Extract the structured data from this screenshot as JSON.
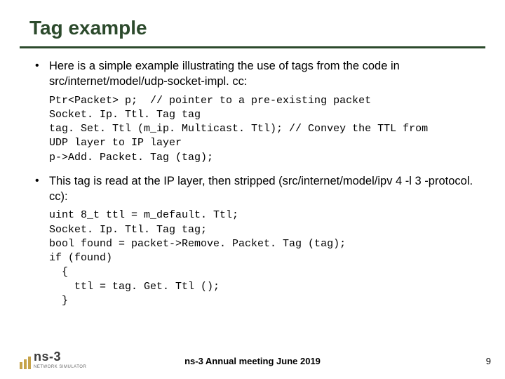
{
  "title": "Tag example",
  "bullets": {
    "b1": "Here is a simple example illustrating the use of tags from the code in src/internet/model/udp-socket-impl. cc:",
    "b2": "This tag is read at the IP layer, then stripped (src/internet/model/ipv 4 -l 3 -protocol. cc):"
  },
  "code": {
    "c1": "Ptr<Packet> p;  // pointer to a pre-existing packet\nSocket. Ip. Ttl. Tag tag\ntag. Set. Ttl (m_ip. Multicast. Ttl); // Convey the TTL from\nUDP layer to IP layer\np->Add. Packet. Tag (tag);",
    "c2": "uint 8_t ttl = m_default. Ttl;\nSocket. Ip. Ttl. Tag tag;\nbool found = packet->Remove. Packet. Tag (tag);\nif (found)\n  {\n    ttl = tag. Get. Ttl ();\n  }"
  },
  "footer": {
    "center": "ns-3 Annual meeting June 2019",
    "page": "9",
    "logo_text": "ns-3",
    "logo_sub": "NETWORK SIMULATOR"
  }
}
